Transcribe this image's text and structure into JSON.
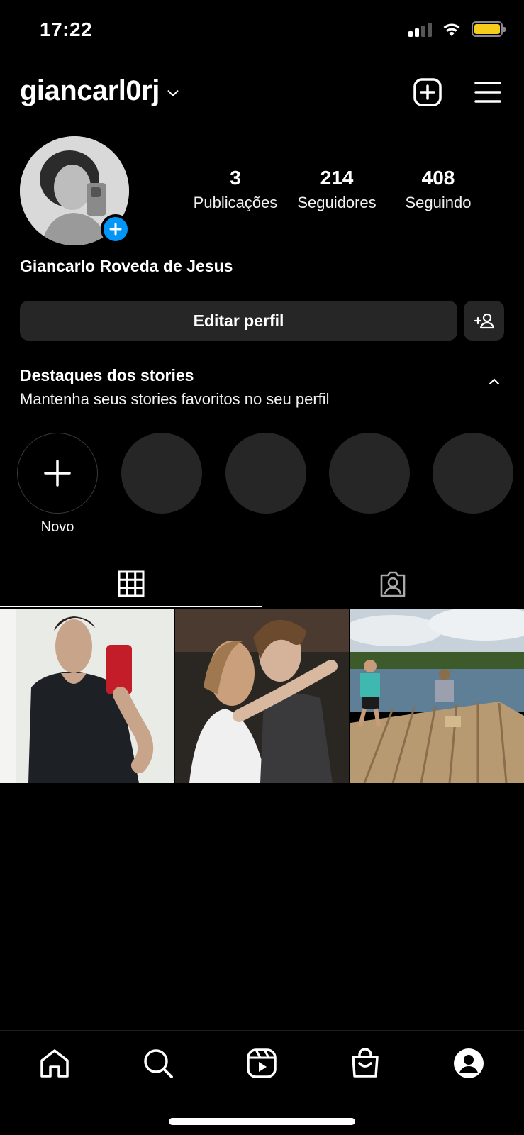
{
  "status_bar": {
    "time": "17:22"
  },
  "header": {
    "username": "giancarl0rj",
    "icons": {
      "switch": "chevron-down-icon",
      "create": "add-square-icon",
      "menu": "hamburger-menu-icon"
    }
  },
  "profile": {
    "stats": [
      {
        "value": "3",
        "label": "Publicações"
      },
      {
        "value": "214",
        "label": "Seguidores"
      },
      {
        "value": "408",
        "label": "Seguindo"
      }
    ],
    "full_name": "Giancarlo Roveda de Jesus",
    "edit_label": "Editar perfil"
  },
  "highlights": {
    "title": "Destaques dos stories",
    "subtitle": "Mantenha seus stories favoritos no seu perfil",
    "new_label": "Novo"
  },
  "tabs": [
    {
      "name": "grid",
      "icon": "grid-icon",
      "active": true
    },
    {
      "name": "tagged",
      "icon": "tagged-person-icon",
      "active": false
    }
  ],
  "nav": [
    "home-icon",
    "search-icon",
    "reels-icon",
    "shop-icon",
    "profile-icon"
  ],
  "colors": {
    "accent": "#0095f6",
    "button_bg": "#262626",
    "battery": "#f7cd1b"
  }
}
